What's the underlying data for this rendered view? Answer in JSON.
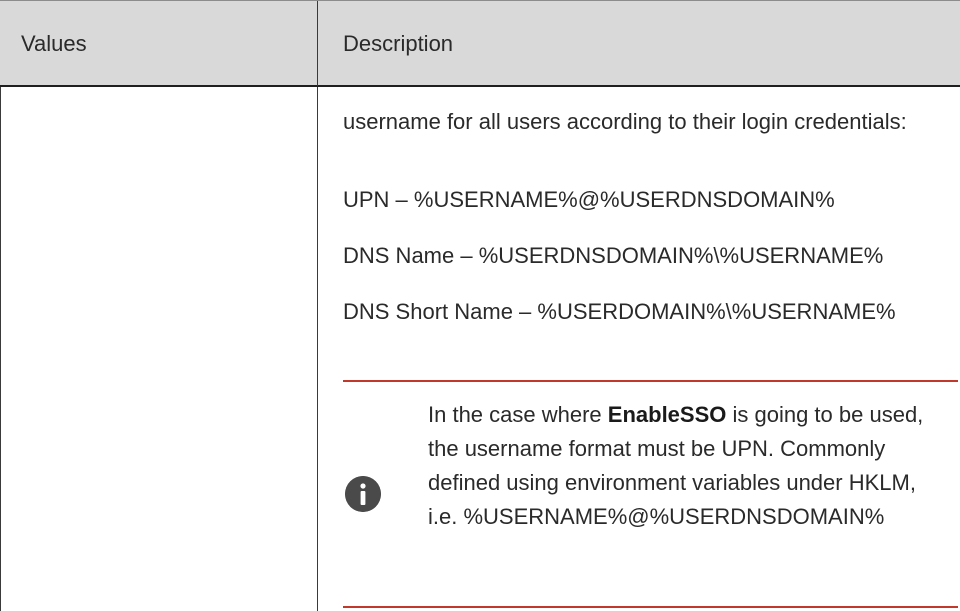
{
  "table": {
    "headers": {
      "values": "Values",
      "description": "Description"
    },
    "row": {
      "value": "",
      "description": {
        "intro": "username for all users according to their login credentials:",
        "upn": "UPN – %USERNAME%@%USERDNSDOMAIN%",
        "dns_name": "DNS Name – %USERDNSDOMAIN%\\%USERNAME%",
        "dns_short_name": "DNS Short Name – %USERDOMAIN%\\%USERNAME%"
      }
    }
  },
  "note": {
    "icon": "info-icon",
    "text_before": "In the case where ",
    "bold": "EnableSSO",
    "text_after": " is going to be used, the username format must be UPN. Commonly defined using environment variables under HKLM, i.e. %USERNAME%@%USERDNSDOMAIN%",
    "rule_color": "#c0392b"
  }
}
